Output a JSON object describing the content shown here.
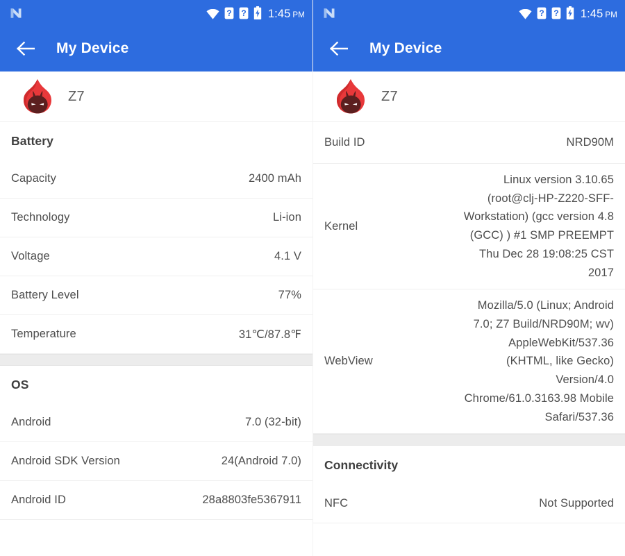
{
  "statusbar": {
    "os_logo": "android-nougat-n-logo",
    "icons": [
      "wifi-icon",
      "sim-card-question-icon",
      "sim-card-question-icon",
      "battery-charging-icon"
    ],
    "time": "1:45",
    "ampm": "PM"
  },
  "appbar": {
    "back_label": "back-arrow-icon",
    "title": "My Device"
  },
  "device": {
    "logo": "antutu-benchmark-logo",
    "name": "Z7"
  },
  "colors": {
    "accent_blue": "#2d6cdf",
    "section_divider": "#ececec",
    "text_primary": "#4d4d4d",
    "text_heading": "#3f3f3f",
    "logo_flame": "#e8383a",
    "logo_face": "#5c1f1f"
  },
  "left_panel": {
    "sections": [
      {
        "title": "Battery",
        "rows": [
          {
            "label": "Capacity",
            "value": "2400 mAh"
          },
          {
            "label": "Technology",
            "value": "Li-ion"
          },
          {
            "label": "Voltage",
            "value": "4.1 V"
          },
          {
            "label": "Battery Level",
            "value": "77%"
          },
          {
            "label": "Temperature",
            "value": "31℃/87.8℉"
          }
        ]
      },
      {
        "title": "OS",
        "rows": [
          {
            "label": "Android",
            "value": "7.0 (32-bit)"
          },
          {
            "label": "Android SDK Version",
            "value": "24(Android 7.0)"
          },
          {
            "label": "Android ID",
            "value": "28a8803fe5367911"
          }
        ]
      }
    ]
  },
  "right_panel": {
    "sections": [
      {
        "title": "",
        "rows": [
          {
            "label": "Build ID",
            "value": "NRD90M"
          },
          {
            "label": "Kernel",
            "value": "Linux version 3.10.65 (root@clj-HP-Z220-SFF-Workstation) (gcc version 4.8 (GCC) ) #1 SMP PREEMPT Thu Dec 28 19:08:25 CST 2017"
          },
          {
            "label": "WebView",
            "value": "Mozilla/5.0 (Linux; Android 7.0; Z7 Build/NRD90M; wv) AppleWebKit/537.36 (KHTML, like Gecko) Version/4.0 Chrome/61.0.3163.98 Mobile Safari/537.36"
          }
        ]
      },
      {
        "title": "Connectivity",
        "rows": [
          {
            "label": "NFC",
            "value": "Not Supported"
          }
        ]
      }
    ]
  }
}
